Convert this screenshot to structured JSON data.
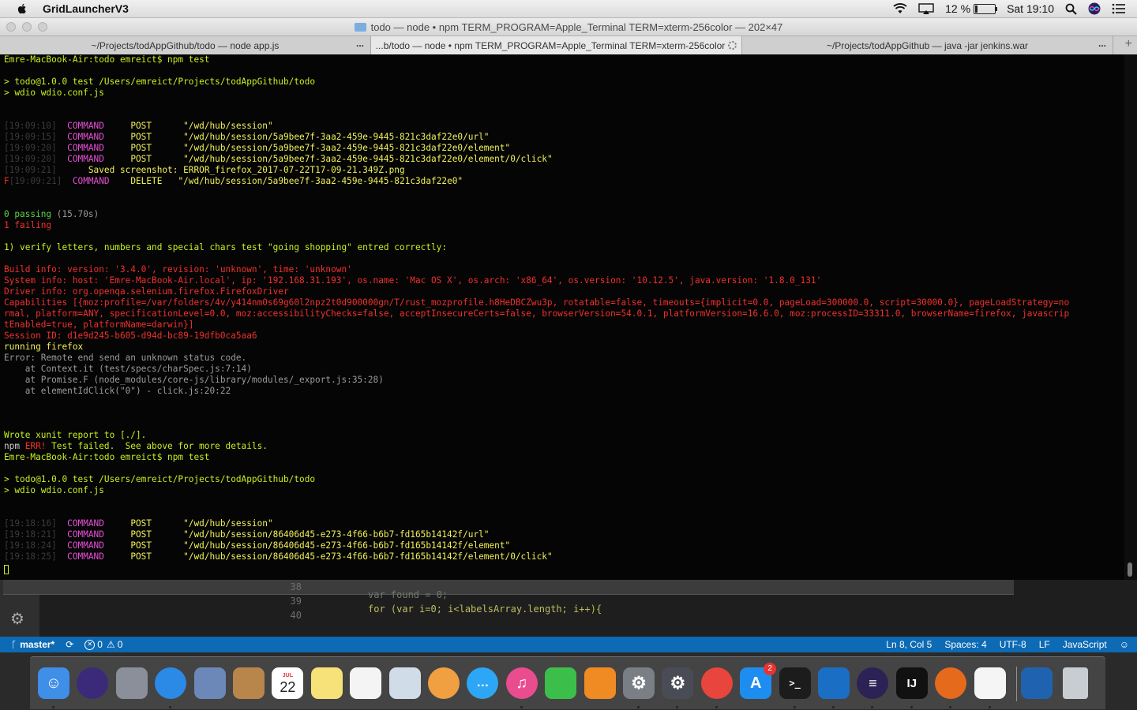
{
  "menubar": {
    "app_name": "GridLauncherV3",
    "battery_percent_label": "12 %",
    "battery_level": 0.12,
    "clock": "Sat 19:10"
  },
  "terminal": {
    "window_title": "todo — node • npm TERM_PROGRAM=Apple_Terminal TERM=xterm-256color — 202×47",
    "tabs": [
      {
        "label": "~/Projects/todAppGithub/todo — node app.js",
        "more": "..."
      },
      {
        "label": "...b/todo — node • npm TERM_PROGRAM=Apple_Terminal TERM=xterm-256color",
        "more": ""
      },
      {
        "label": "~/Projects/todAppGithub — java -jar jenkins.war",
        "more": "..."
      }
    ],
    "new_tab": "+",
    "lines": [
      {
        "segments": [
          {
            "c": "g",
            "t": "Emre-MacBook-Air:todo emreict$ npm test"
          }
        ]
      },
      {
        "segments": []
      },
      {
        "segments": [
          {
            "c": "g",
            "t": "> todo@1.0.0 test /Users/emreict/Projects/todAppGithub/todo"
          }
        ]
      },
      {
        "segments": [
          {
            "c": "g",
            "t": "> wdio wdio.conf.js"
          }
        ]
      },
      {
        "segments": []
      },
      {
        "segments": []
      },
      {
        "segments": [
          {
            "c": "ts",
            "t": "[19:09:10]  "
          },
          {
            "c": "m",
            "t": "COMMAND     "
          },
          {
            "c": "y",
            "t": "POST      \"/wd/hub/session\""
          }
        ]
      },
      {
        "segments": [
          {
            "c": "ts",
            "t": "[19:09:15]  "
          },
          {
            "c": "m",
            "t": "COMMAND     "
          },
          {
            "c": "y",
            "t": "POST      \"/wd/hub/session/5a9bee7f-3aa2-459e-9445-821c3daf22e0/url\""
          }
        ]
      },
      {
        "segments": [
          {
            "c": "ts",
            "t": "[19:09:20]  "
          },
          {
            "c": "m",
            "t": "COMMAND     "
          },
          {
            "c": "y",
            "t": "POST      \"/wd/hub/session/5a9bee7f-3aa2-459e-9445-821c3daf22e0/element\""
          }
        ]
      },
      {
        "segments": [
          {
            "c": "ts",
            "t": "[19:09:20]  "
          },
          {
            "c": "m",
            "t": "COMMAND     "
          },
          {
            "c": "y",
            "t": "POST      \"/wd/hub/session/5a9bee7f-3aa2-459e-9445-821c3daf22e0/element/0/click\""
          }
        ]
      },
      {
        "segments": [
          {
            "c": "ts",
            "t": "[19:09:21]      "
          },
          {
            "c": "y",
            "t": "Saved screenshot: ERROR_firefox_2017-07-22T17-09-21.349Z.png"
          }
        ]
      },
      {
        "segments": [
          {
            "c": "r",
            "t": "F"
          },
          {
            "c": "ts",
            "t": "[19:09:21]  "
          },
          {
            "c": "m",
            "t": "COMMAND    "
          },
          {
            "c": "y",
            "t": "DELETE   \"/wd/hub/session/5a9bee7f-3aa2-459e-9445-821c3daf22e0\""
          }
        ]
      },
      {
        "segments": []
      },
      {
        "segments": []
      },
      {
        "segments": [
          {
            "c": "gn",
            "t": "0 passing "
          },
          {
            "c": "gr",
            "t": "(15.70s)"
          }
        ]
      },
      {
        "segments": [
          {
            "c": "r",
            "t": "1 failing"
          }
        ]
      },
      {
        "segments": []
      },
      {
        "segments": [
          {
            "c": "g",
            "t": "1) verify letters, numbers and special chars test \"going shopping\" entred correctly:"
          }
        ]
      },
      {
        "segments": []
      },
      {
        "segments": [
          {
            "c": "r",
            "t": "Build info: version: '3.4.0', revision: 'unknown', time: 'unknown'"
          }
        ]
      },
      {
        "segments": [
          {
            "c": "r",
            "t": "System info: host: 'Emre-MacBook-Air.local', ip: '192.168.31.193', os.name: 'Mac OS X', os.arch: 'x86_64', os.version: '10.12.5', java.version: '1.8.0_131'"
          }
        ]
      },
      {
        "segments": [
          {
            "c": "r",
            "t": "Driver info: org.openqa.selenium.firefox.FirefoxDriver"
          }
        ]
      },
      {
        "segments": [
          {
            "c": "r",
            "t": "Capabilities [{moz:profile=/var/folders/4v/y414nm0s69g60l2npz2t0d900000gn/T/rust_mozprofile.h8HeDBCZwu3p, rotatable=false, timeouts={implicit=0.0, pageLoad=300000.0, script=30000.0}, pageLoadStrategy=no"
          }
        ]
      },
      {
        "segments": [
          {
            "c": "r",
            "t": "rmal, platform=ANY, specificationLevel=0.0, moz:accessibilityChecks=false, acceptInsecureCerts=false, browserVersion=54.0.1, platformVersion=16.6.0, moz:processID=33311.0, browserName=firefox, javascrip"
          }
        ]
      },
      {
        "segments": [
          {
            "c": "r",
            "t": "tEnabled=true, platformName=darwin}]"
          }
        ]
      },
      {
        "segments": [
          {
            "c": "r",
            "t": "Session ID: d1e9d245-b605-d94d-bc89-19dfb0ca5aa6"
          }
        ]
      },
      {
        "segments": [
          {
            "c": "y",
            "t": "running firefox"
          }
        ]
      },
      {
        "segments": [
          {
            "c": "gr",
            "t": "Error: Remote end send an unknown status code."
          }
        ]
      },
      {
        "segments": [
          {
            "c": "gr",
            "t": "    at Context.it (test/specs/charSpec.js:7:14)"
          }
        ]
      },
      {
        "segments": [
          {
            "c": "gr",
            "t": "    at Promise.F (node_modules/core-js/library/modules/_export.js:35:28)"
          }
        ]
      },
      {
        "segments": [
          {
            "c": "gr",
            "t": "    at elementIdClick(\"0\") - click.js:20:22"
          }
        ]
      },
      {
        "segments": []
      },
      {
        "segments": []
      },
      {
        "segments": []
      },
      {
        "segments": [
          {
            "c": "g",
            "t": "Wrote xunit report to [./]."
          }
        ]
      },
      {
        "segments": [
          {
            "c": "w",
            "t": "npm "
          },
          {
            "c": "r",
            "t": "ERR!"
          },
          {
            "c": "g",
            "t": " Test failed.  See above for more details."
          }
        ]
      },
      {
        "segments": [
          {
            "c": "g",
            "t": "Emre-MacBook-Air:todo emreict$ npm test"
          }
        ]
      },
      {
        "segments": []
      },
      {
        "segments": [
          {
            "c": "g",
            "t": "> todo@1.0.0 test /Users/emreict/Projects/todAppGithub/todo"
          }
        ]
      },
      {
        "segments": [
          {
            "c": "g",
            "t": "> wdio wdio.conf.js"
          }
        ]
      },
      {
        "segments": []
      },
      {
        "segments": []
      },
      {
        "segments": [
          {
            "c": "ts",
            "t": "[19:18:16]  "
          },
          {
            "c": "m",
            "t": "COMMAND     "
          },
          {
            "c": "y",
            "t": "POST      \"/wd/hub/session\""
          }
        ]
      },
      {
        "segments": [
          {
            "c": "ts",
            "t": "[19:18:21]  "
          },
          {
            "c": "m",
            "t": "COMMAND     "
          },
          {
            "c": "y",
            "t": "POST      \"/wd/hub/session/86406d45-e273-4f66-b6b7-fd165b14142f/url\""
          }
        ]
      },
      {
        "segments": [
          {
            "c": "ts",
            "t": "[19:18:24]  "
          },
          {
            "c": "m",
            "t": "COMMAND     "
          },
          {
            "c": "y",
            "t": "POST      \"/wd/hub/session/86406d45-e273-4f66-b6b7-fd165b14142f/element\""
          }
        ]
      },
      {
        "segments": [
          {
            "c": "ts",
            "t": "[19:18:25]  "
          },
          {
            "c": "m",
            "t": "COMMAND     "
          },
          {
            "c": "y",
            "t": "POST      \"/wd/hub/session/86406d45-e273-4f66-b6b7-fd165b14142f/element/0/click\""
          }
        ]
      }
    ]
  },
  "editor": {
    "line_numbers": [
      "38",
      "39",
      "40"
    ],
    "code_lines": [
      "var found = 0;",
      "for (var i=0; i<labelsArray.length; i++){"
    ]
  },
  "statusbar": {
    "branch": "master*",
    "errors": "0",
    "warnings": "0",
    "cursor_pos": "Ln 8, Col 5",
    "spaces": "Spaces: 4",
    "encoding": "UTF-8",
    "eol": "LF",
    "language": "JavaScript"
  },
  "dock": {
    "calendar_month": "JUL",
    "calendar_day": "22",
    "app_store_badge": "2",
    "intellij_label": "IJ",
    "items": [
      {
        "name": "finder-icon",
        "color": "#3f8ee8",
        "running": true
      },
      {
        "name": "siri-icon",
        "color": "#3b2a7a",
        "running": false
      },
      {
        "name": "launchpad-icon",
        "color": "#8a8f99",
        "running": false
      },
      {
        "name": "safari-icon",
        "color": "#2b8ae6",
        "running": true
      },
      {
        "name": "preview-icon",
        "color": "#6c88b8",
        "running": false
      },
      {
        "name": "contacts-icon",
        "color": "#b8864a",
        "running": false
      },
      {
        "name": "calendar-icon",
        "color": "#ffffff",
        "running": false
      },
      {
        "name": "notes-icon",
        "color": "#f7e27a",
        "running": false
      },
      {
        "name": "reminders-icon",
        "color": "#f4f4f4",
        "running": false
      },
      {
        "name": "app-icon",
        "color": "#d0dde8",
        "running": false
      },
      {
        "name": "photos-icon",
        "color": "#f0a040",
        "running": false
      },
      {
        "name": "messages-icon",
        "color": "#2da6f5",
        "running": false
      },
      {
        "name": "itunes-icon",
        "color": "#e94c8f",
        "running": true
      },
      {
        "name": "facetime-icon",
        "color": "#3cbf4a",
        "running": false
      },
      {
        "name": "ibooks-icon",
        "color": "#f08a23",
        "running": false
      },
      {
        "name": "system-preferences-icon",
        "color": "#7a7f86",
        "running": true
      },
      {
        "name": "gear-app-icon",
        "color": "#4a4c55",
        "running": true
      },
      {
        "name": "chrome-icon",
        "color": "#e8453c",
        "running": true
      },
      {
        "name": "app-store-icon",
        "color": "#1d8ef0",
        "running": false
      },
      {
        "name": "terminal-icon",
        "color": "#1c1c1c",
        "running": true
      },
      {
        "name": "visual-studio-code-icon",
        "color": "#1a6fc4",
        "running": true
      },
      {
        "name": "eclipse-icon",
        "color": "#2c2255",
        "running": true
      },
      {
        "name": "intellij-icon",
        "color": "#111111",
        "running": true
      },
      {
        "name": "firefox-icon",
        "color": "#e66a1c",
        "running": true
      },
      {
        "name": "java-icon",
        "color": "#f5f5f5",
        "running": true
      },
      {
        "name": "visual-studio-icon",
        "color": "#1f63b0",
        "running": false
      },
      {
        "name": "trash-icon",
        "color": "#c8cdd2",
        "running": false
      }
    ]
  }
}
